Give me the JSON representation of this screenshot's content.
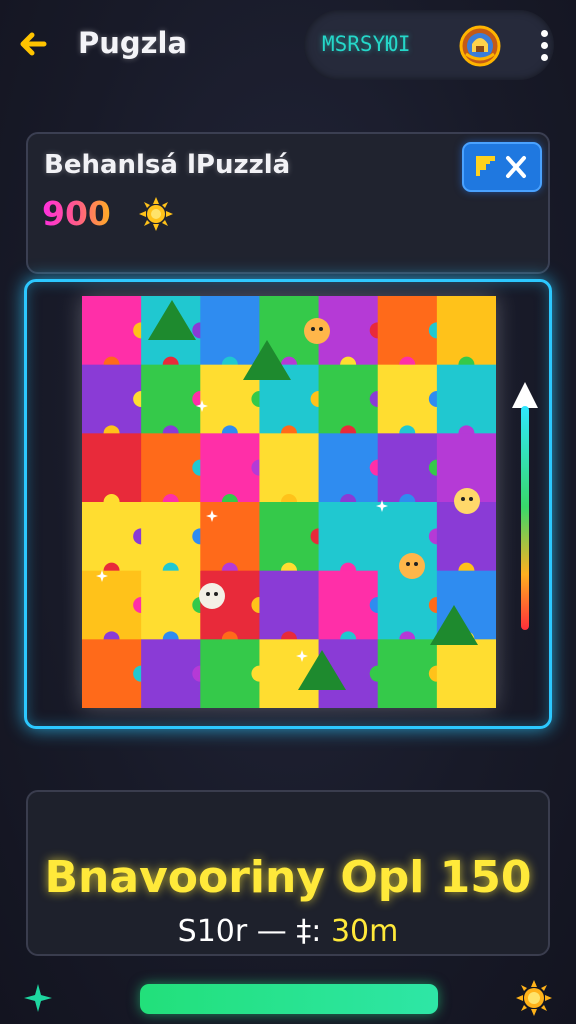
{
  "header": {
    "title": "Pugzla",
    "username": "MSRSYЮI",
    "back_icon": "arrow-left-icon",
    "trophy_icon": "trophy-badge-icon",
    "menu_icon": "more-vertical-icon"
  },
  "info": {
    "puzzle_name": "Behanlsá lPuzzlá",
    "score": "900",
    "score_icon": "sun-icon",
    "action_icon": "hint-close-icon"
  },
  "board": {
    "rows": 6,
    "cols": 7,
    "progress_level": 0.8,
    "frame_color": "#2cc8ff"
  },
  "result": {
    "title": "Bnavooriny Opl 150",
    "time_prefix": "S10r — ‡: ",
    "time_value": "30m"
  },
  "footer": {
    "left_icon": "sparkle-icon",
    "right_icon": "sun-icon",
    "bar_color": "#22e07a"
  },
  "colors": {
    "accent_cyan": "#25d7c9",
    "accent_yellow": "#ffe93a",
    "button_blue": "#1f78e0"
  }
}
